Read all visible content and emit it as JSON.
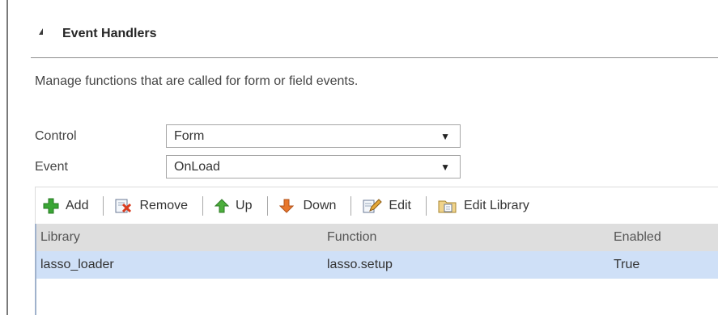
{
  "section": {
    "title": "Event Handlers",
    "description": "Manage functions that are called for form or field events."
  },
  "fields": {
    "control": {
      "label": "Control",
      "value": "Form"
    },
    "event": {
      "label": "Event",
      "value": "OnLoad"
    }
  },
  "toolbar": {
    "add": "Add",
    "remove": "Remove",
    "up": "Up",
    "down": "Down",
    "edit": "Edit",
    "edit_library": "Edit Library"
  },
  "grid": {
    "columns": [
      "Library",
      "Function",
      "Enabled"
    ],
    "rows": [
      [
        "lasso_loader",
        "lasso.setup",
        "True"
      ]
    ]
  },
  "colors": {
    "selected_row": "#cfe0f7",
    "header_row": "#dedede",
    "add_green": "#3aa635",
    "arrow_green": "#4caf3c",
    "arrow_orange": "#e8762b"
  }
}
